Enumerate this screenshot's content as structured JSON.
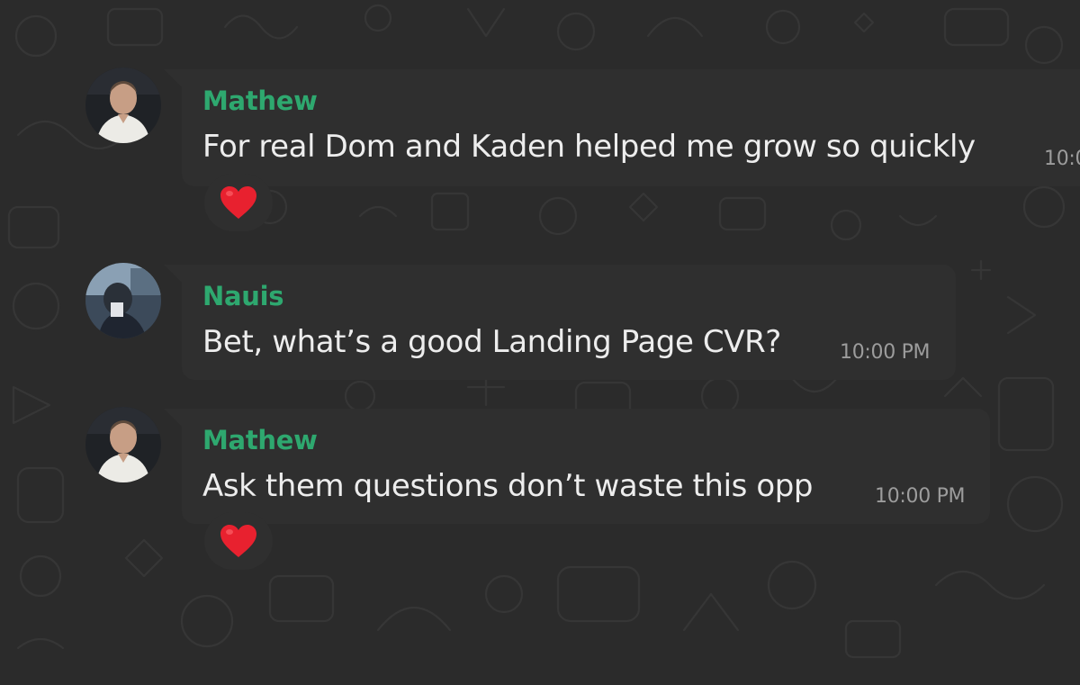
{
  "chat": {
    "messages": [
      {
        "sender": "Mathew",
        "text": "For real Dom and Kaden helped me grow so quickly",
        "time": "10:0",
        "reaction": "heart-icon"
      },
      {
        "sender": "Nauis",
        "text": "Bet, what’s a good Landing Page CVR?",
        "time": "10:00 PM",
        "reaction": null
      },
      {
        "sender": "Mathew",
        "text": "Ask them questions don’t waste this opp",
        "time": "10:00 PM",
        "reaction": "heart-icon"
      }
    ]
  },
  "colors": {
    "background": "#2b2b2b",
    "bubble": "#2f2f2f",
    "sender_name": "#2ea86f",
    "message_text": "#ededed",
    "timestamp": "#9c9c9c",
    "heart": "#e8212f"
  }
}
